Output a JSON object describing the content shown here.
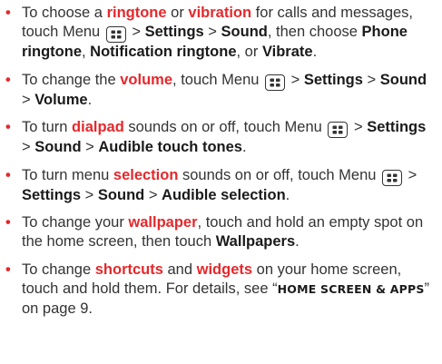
{
  "colors": {
    "accent": "#e5282c",
    "text": "#333333"
  },
  "icons": {
    "bullet": "bullet-dot",
    "menu_key": "menu-key-icon"
  },
  "items": [
    {
      "segments": [
        {
          "text": "To choose a ",
          "style": "plain"
        },
        {
          "text": "ringtone",
          "style": "hl"
        },
        {
          "text": " or ",
          "style": "plain"
        },
        {
          "text": "vibration",
          "style": "hl"
        },
        {
          "text": " for calls and messages, touch Menu ",
          "style": "plain"
        },
        {
          "style": "menu"
        },
        {
          "text": " > ",
          "style": "plain"
        },
        {
          "text": "Settings",
          "style": "b"
        },
        {
          "text": " > ",
          "style": "plain"
        },
        {
          "text": "Sound",
          "style": "b"
        },
        {
          "text": ", then choose ",
          "style": "plain"
        },
        {
          "text": "Phone ringtone",
          "style": "b"
        },
        {
          "text": ", ",
          "style": "plain"
        },
        {
          "text": "Notification ringtone",
          "style": "b"
        },
        {
          "text": ", or ",
          "style": "plain"
        },
        {
          "text": "Vibrate",
          "style": "b"
        },
        {
          "text": ".",
          "style": "plain"
        }
      ]
    },
    {
      "segments": [
        {
          "text": "To change the ",
          "style": "plain"
        },
        {
          "text": "volume",
          "style": "hl"
        },
        {
          "text": ", touch Menu ",
          "style": "plain"
        },
        {
          "style": "menu"
        },
        {
          "text": " > ",
          "style": "plain"
        },
        {
          "text": "Settings",
          "style": "b"
        },
        {
          "text": " > ",
          "style": "plain"
        },
        {
          "text": "Sound",
          "style": "b"
        },
        {
          "text": " > ",
          "style": "plain"
        },
        {
          "text": "Volume",
          "style": "b"
        },
        {
          "text": ".",
          "style": "plain"
        }
      ]
    },
    {
      "segments": [
        {
          "text": "To turn ",
          "style": "plain"
        },
        {
          "text": "dialpad",
          "style": "hl"
        },
        {
          "text": " sounds on or off, touch Menu ",
          "style": "plain"
        },
        {
          "style": "menu"
        },
        {
          "text": " > ",
          "style": "plain"
        },
        {
          "text": "Settings",
          "style": "b"
        },
        {
          "text": " > ",
          "style": "plain"
        },
        {
          "text": "Sound",
          "style": "b"
        },
        {
          "text": " > ",
          "style": "plain"
        },
        {
          "text": "Audible touch tones",
          "style": "b"
        },
        {
          "text": ".",
          "style": "plain"
        }
      ]
    },
    {
      "segments": [
        {
          "text": "To turn menu ",
          "style": "plain"
        },
        {
          "text": "selection",
          "style": "hl"
        },
        {
          "text": " sounds on or off, touch Menu ",
          "style": "plain"
        },
        {
          "style": "menu"
        },
        {
          "text": " > ",
          "style": "plain"
        },
        {
          "text": "Settings",
          "style": "b"
        },
        {
          "text": " > ",
          "style": "plain"
        },
        {
          "text": "Sound",
          "style": "b"
        },
        {
          "text": " > ",
          "style": "plain"
        },
        {
          "text": "Audible selection",
          "style": "b"
        },
        {
          "text": ".",
          "style": "plain"
        }
      ]
    },
    {
      "segments": [
        {
          "text": "To change your ",
          "style": "plain"
        },
        {
          "text": "wallpaper",
          "style": "hl"
        },
        {
          "text": ", touch and hold an empty spot on the home screen, then touch ",
          "style": "plain"
        },
        {
          "text": "Wallpapers",
          "style": "b"
        },
        {
          "text": ".",
          "style": "plain"
        }
      ]
    },
    {
      "segments": [
        {
          "text": "To change ",
          "style": "plain"
        },
        {
          "text": "shortcuts",
          "style": "hl"
        },
        {
          "text": " and ",
          "style": "plain"
        },
        {
          "text": "widgets",
          "style": "hl"
        },
        {
          "text": " on your home screen, touch and hold them. For details, see “",
          "style": "plain"
        },
        {
          "text": "Home screen & apps",
          "style": "xref"
        },
        {
          "text": "” on page 9.",
          "style": "plain"
        }
      ]
    }
  ]
}
